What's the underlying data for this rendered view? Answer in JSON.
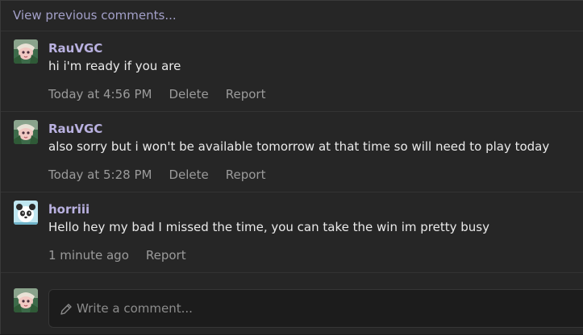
{
  "view_previous": "View previous comments...",
  "comments": [
    {
      "username": "RauVGC",
      "text": "hi i'm ready if you are",
      "time": "Today at 4:56 PM",
      "delete_label": "Delete",
      "report_label": "Report"
    },
    {
      "username": "RauVGC",
      "text": "also sorry but i won't be available tomorrow at that time so will need to play today",
      "time": "Today at 5:28 PM",
      "delete_label": "Delete",
      "report_label": "Report"
    },
    {
      "username": "horriii",
      "text": "Hello hey my bad I missed the time, you can take the win im pretty busy",
      "time": "1 minute ago",
      "report_label": "Report"
    }
  ],
  "compose": {
    "placeholder": "Write a comment..."
  },
  "colors": {
    "username": "#b9b1e0",
    "link": "#a3a0c9",
    "meta": "#9b9b9b",
    "background": "#262626"
  }
}
